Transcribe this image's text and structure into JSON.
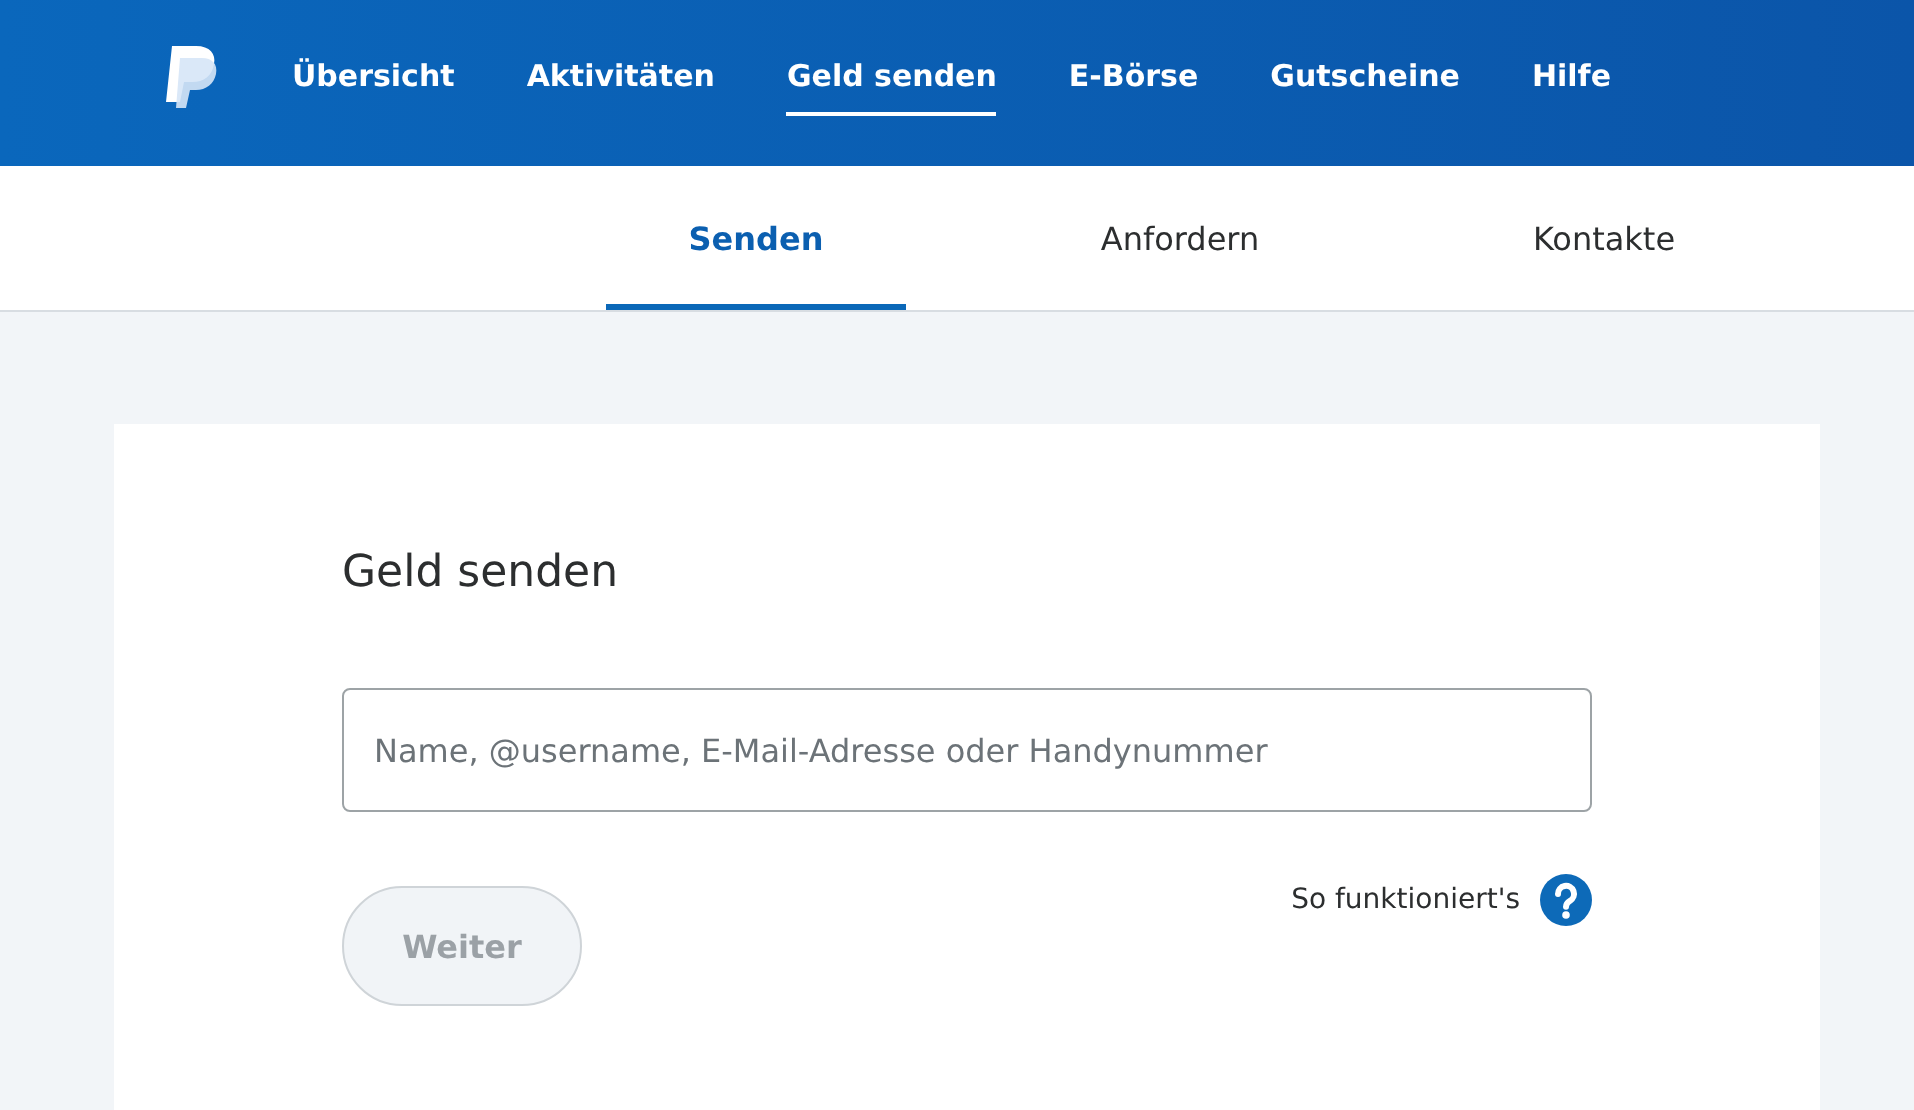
{
  "nav": [
    {
      "label": "Übersicht",
      "selected": false
    },
    {
      "label": "Aktivitäten",
      "selected": false
    },
    {
      "label": "Geld senden",
      "selected": true
    },
    {
      "label": "E-Börse",
      "selected": false
    },
    {
      "label": "Gutscheine",
      "selected": false
    },
    {
      "label": "Hilfe",
      "selected": false
    }
  ],
  "subnav": [
    {
      "label": "Senden",
      "selected": true
    },
    {
      "label": "Anfordern",
      "selected": false
    },
    {
      "label": "Kontakte",
      "selected": false
    }
  ],
  "card": {
    "title": "Geld senden",
    "recipient_field": {
      "placeholder": "Name, @username, E-Mail-Adresse oder Handynummer"
    },
    "next_button": {
      "label": "Weiter",
      "disabled": true
    },
    "help_link": "So funktioniert's"
  }
}
